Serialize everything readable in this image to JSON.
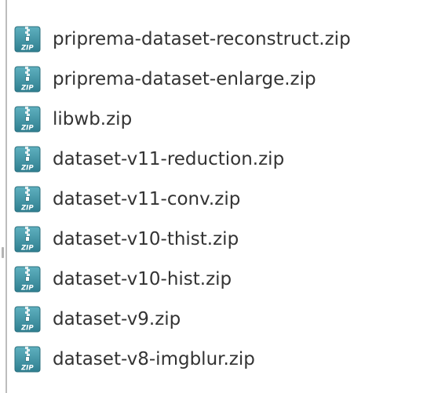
{
  "files": [
    {
      "name": "priprema-dataset-reconstruct.zip",
      "icon": "zip-archive-icon"
    },
    {
      "name": "priprema-dataset-enlarge.zip",
      "icon": "zip-archive-icon"
    },
    {
      "name": "libwb.zip",
      "icon": "zip-archive-icon"
    },
    {
      "name": "dataset-v11-reduction.zip",
      "icon": "zip-archive-icon"
    },
    {
      "name": "dataset-v11-conv.zip",
      "icon": "zip-archive-icon"
    },
    {
      "name": "dataset-v10-thist.zip",
      "icon": "zip-archive-icon"
    },
    {
      "name": "dataset-v10-hist.zip",
      "icon": "zip-archive-icon"
    },
    {
      "name": "dataset-v9.zip",
      "icon": "zip-archive-icon"
    },
    {
      "name": "dataset-v8-imgblur.zip",
      "icon": "zip-archive-icon"
    }
  ],
  "icon_label": "ZIP",
  "colors": {
    "icon_top": "#5fb0bf",
    "icon_bottom": "#2f7f90",
    "zipper": "#e8f1f3",
    "text": "#333333",
    "border": "#bdbdbd"
  }
}
